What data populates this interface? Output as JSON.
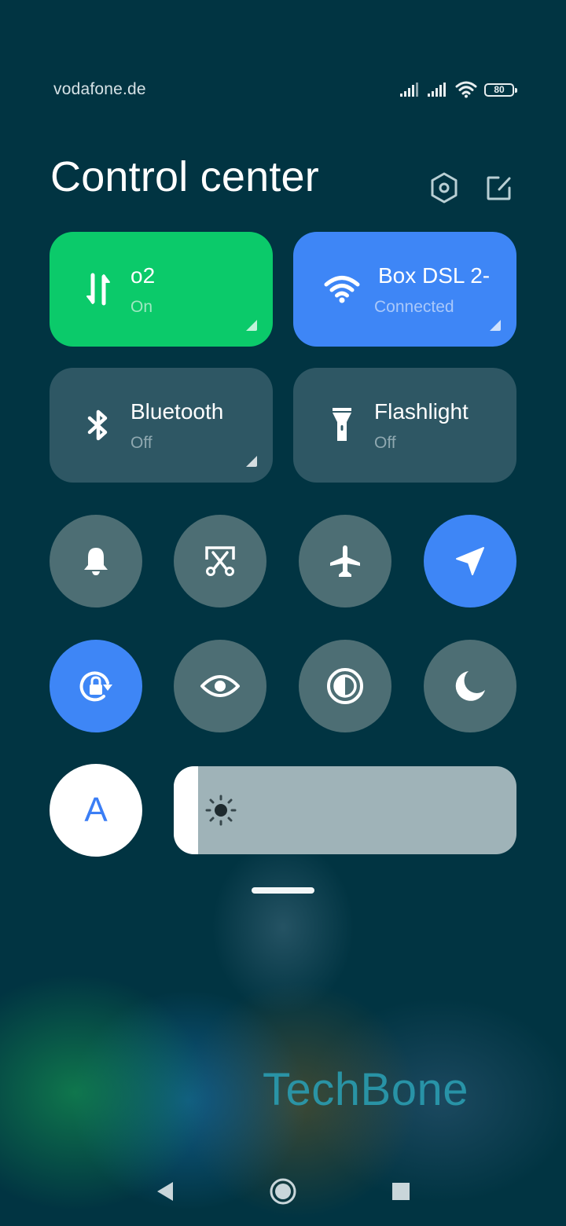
{
  "status_bar": {
    "carrier": "vodafone.de",
    "icons": [
      "signal-sim1-icon",
      "signal-sim2-icon",
      "wifi-icon",
      "battery-icon"
    ],
    "battery_level": "80"
  },
  "header": {
    "title": "Control center",
    "settings_icon": "settings-hexagon-icon",
    "edit_icon": "edit-icon"
  },
  "tiles": [
    {
      "name": "mobile-data",
      "title": "o2",
      "status": "On",
      "icon": "mobile-data-arrows-icon",
      "active": true,
      "color": "#0bca6a",
      "sub_color": "#9ee8c1"
    },
    {
      "name": "wifi",
      "title": "Box DSL 2-",
      "status": "Connected",
      "icon": "wifi-icon",
      "active": true,
      "color": "#3e86f6",
      "sub_color": "#a9c8fa"
    },
    {
      "name": "bluetooth",
      "title": "Bluetooth",
      "status": "Off",
      "icon": "bluetooth-icon",
      "active": false,
      "color": "#2e5764",
      "sub_color": "#8fa8b0"
    },
    {
      "name": "flashlight",
      "title": "Flashlight",
      "status": "Off",
      "icon": "flashlight-icon",
      "active": false,
      "color": "#2e5764",
      "sub_color": "#8fa8b0"
    }
  ],
  "toggles": [
    {
      "name": "ringer",
      "icon": "bell-icon",
      "active": false
    },
    {
      "name": "screenshot",
      "icon": "scissors-screenshot-icon",
      "active": false
    },
    {
      "name": "airplane-mode",
      "icon": "airplane-icon",
      "active": false
    },
    {
      "name": "location",
      "icon": "location-arrow-icon",
      "active": true
    },
    {
      "name": "rotation-lock",
      "icon": "rotation-lock-icon",
      "active": true
    },
    {
      "name": "reading-mode",
      "icon": "eye-icon",
      "active": false
    },
    {
      "name": "dark-mode",
      "icon": "contrast-icon",
      "active": false
    },
    {
      "name": "do-not-disturb",
      "icon": "moon-icon",
      "active": false
    }
  ],
  "colors": {
    "background": "#013442",
    "toggle_inactive": "#4d6e74",
    "toggle_active": "#3e86f6",
    "tile_inactive": "#2e5764"
  },
  "brightness": {
    "auto_label": "A",
    "level_percent": 7
  },
  "watermark": "TechBone",
  "nav_bar": {
    "back_icon": "back-triangle-icon",
    "home_icon": "home-circle-icon",
    "recents_icon": "recents-square-icon"
  }
}
